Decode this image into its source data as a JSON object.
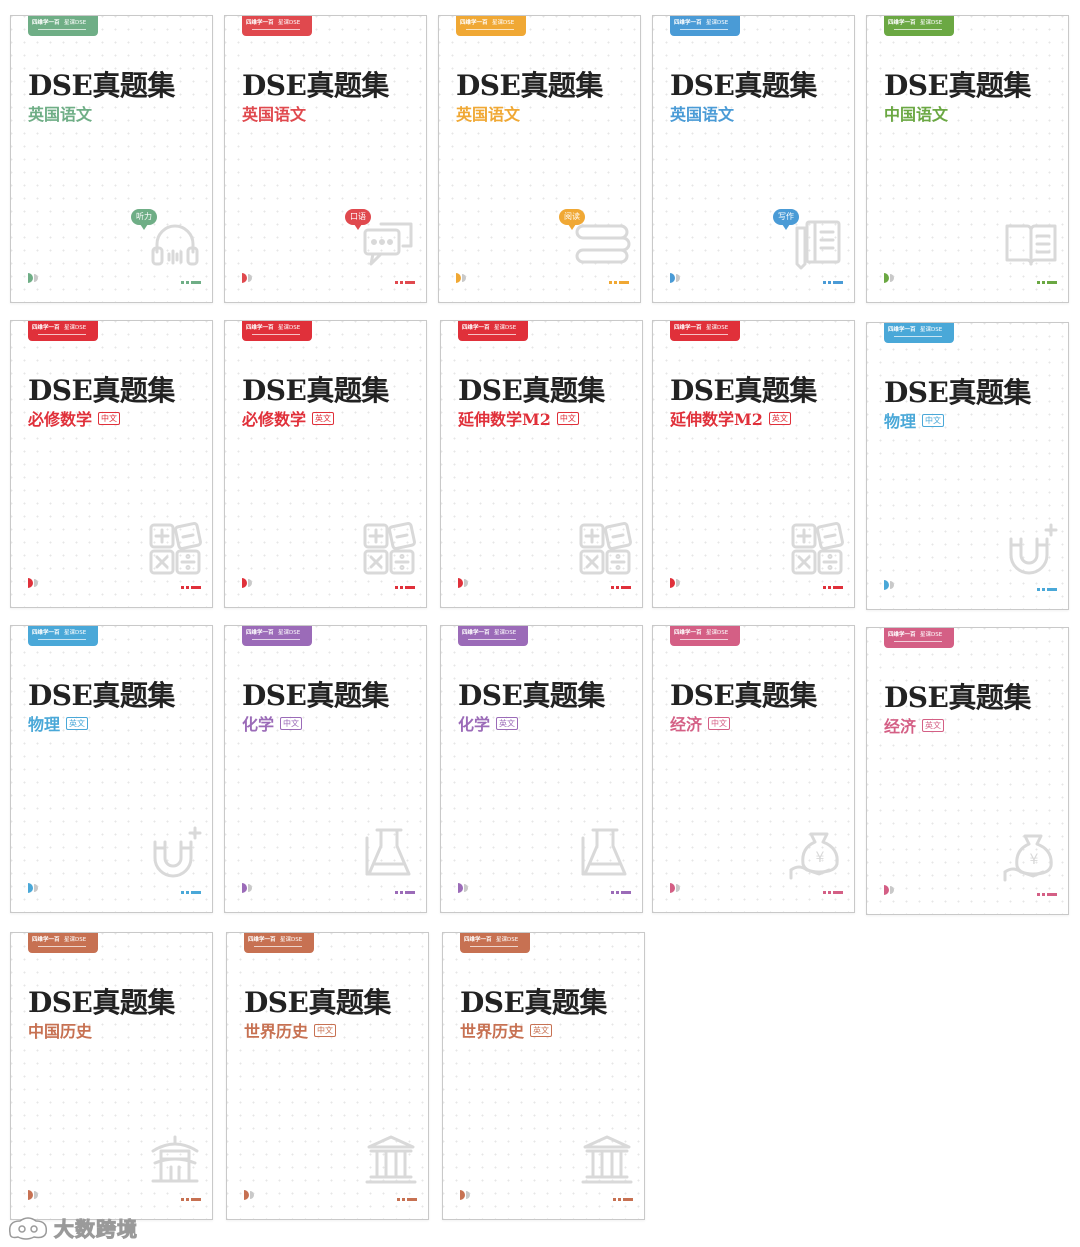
{
  "logo": {
    "brand": "四维学一百",
    "product": "星课DSE"
  },
  "series_title": "DSE真题集",
  "cards": [
    {
      "subject": "英国语文",
      "color": "#6fae86",
      "bubble": "听力",
      "icon": "headphones-icon"
    },
    {
      "subject": "英国语文",
      "color": "#e0494e",
      "bubble": "口语",
      "icon": "chat-icon"
    },
    {
      "subject": "英国语文",
      "color": "#f0a834",
      "bubble": "阅读",
      "icon": "books-icon"
    },
    {
      "subject": "英国语文",
      "color": "#4a9bd6",
      "bubble": "写作",
      "icon": "notebook-icon"
    },
    {
      "subject": "中国语文",
      "color": "#6ba843",
      "icon": "open-book-icon"
    },
    {
      "subject": "必修数学",
      "lang": "中文",
      "color": "#e0303a",
      "icon": "calculator-icon"
    },
    {
      "subject": "必修数学",
      "lang": "英文",
      "color": "#e0303a",
      "icon": "calculator-icon"
    },
    {
      "subject": "延伸数学M2",
      "lang": "中文",
      "color": "#e0303a",
      "icon": "calculator-icon"
    },
    {
      "subject": "延伸数学M2",
      "lang": "英文",
      "color": "#e0303a",
      "icon": "calculator-icon"
    },
    {
      "subject": "物理",
      "lang": "中文",
      "color": "#4aa8d8",
      "icon": "magnet-icon"
    },
    {
      "subject": "物理",
      "lang": "英文",
      "color": "#4aa8d8",
      "icon": "magnet-icon"
    },
    {
      "subject": "化学",
      "lang": "中文",
      "color": "#9b6bb8",
      "icon": "flask-icon"
    },
    {
      "subject": "化学",
      "lang": "英文",
      "color": "#9b6bb8",
      "icon": "flask-icon"
    },
    {
      "subject": "经济",
      "lang": "中文",
      "color": "#d45f85",
      "icon": "money-bag-icon"
    },
    {
      "subject": "经济",
      "lang": "英文",
      "color": "#d45f85",
      "icon": "money-bag-icon"
    },
    {
      "subject": "中国历史",
      "color": "#c77152",
      "icon": "pavilion-icon"
    },
    {
      "subject": "世界历史",
      "lang": "中文",
      "color": "#c77152",
      "icon": "temple-icon"
    },
    {
      "subject": "世界历史",
      "lang": "英文",
      "color": "#c77152",
      "icon": "temple-icon"
    }
  ],
  "watermark": {
    "text": "大数跨境"
  }
}
